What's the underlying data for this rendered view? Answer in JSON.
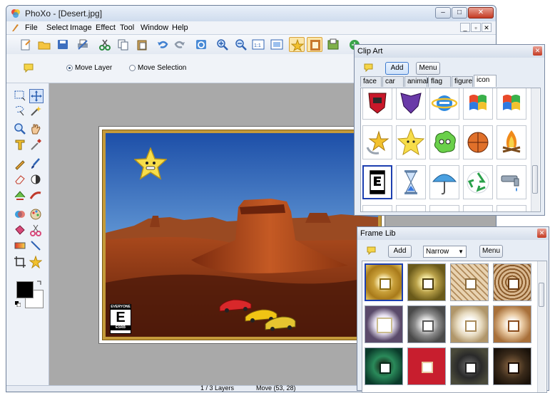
{
  "app": {
    "title": "PhoXo - [Desert.jpg]",
    "menus": [
      "File",
      "Select",
      "Image",
      "Effect",
      "Tool",
      "Window",
      "Help"
    ]
  },
  "toolbar_icons": [
    "new-file",
    "open-folder",
    "save",
    "print",
    "cut",
    "copy",
    "paste",
    "undo",
    "redo",
    "refresh",
    "zoom-in",
    "zoom-out",
    "actual-size",
    "fit-window",
    "star-tool",
    "frame-tool",
    "export",
    "globe"
  ],
  "options": {
    "move_layer": "Move Layer",
    "move_selection": "Move Selection",
    "selected": "move_layer"
  },
  "status": {
    "layers": "1 / 3 Layers",
    "position": "Move (53, 28)"
  },
  "clipart": {
    "title": "Clip Art",
    "add_label": "Add",
    "menu_label": "Menu",
    "tabs": [
      "face",
      "car",
      "animal",
      "flag",
      "figure",
      "icon"
    ],
    "active_tab": "icon",
    "items": [
      "autobots-icon",
      "decepticons-icon",
      "internet-explorer-icon",
      "windows-flag-blue-icon",
      "windows-flag-icon",
      "star-swoosh-icon",
      "smiling-star-icon",
      "green-blob-face-icon",
      "basketball-icon",
      "campfire-icon",
      "esrb-everyone-icon",
      "hourglass-icon",
      "umbrella-icon",
      "recycle-icon",
      "faucet-icon"
    ]
  },
  "framelib": {
    "title": "Frame Lib",
    "add_label": "Add",
    "style_value": "Narrow",
    "menu_label": "Menu",
    "frames": [
      "gold-frame",
      "olive-frame",
      "beige-pattern-frame",
      "brown-wave-frame",
      "purple-frame",
      "grey-frame",
      "cream-frame",
      "tan-frame",
      "green-frame",
      "red-frame",
      "dark-grey-frame",
      "dark-brown-frame"
    ]
  },
  "canvas": {
    "esrb_rating": "E",
    "esrb_top": "EVERYONE",
    "esrb_bottom": "ESRB"
  },
  "colors": {
    "foreground": "#000000",
    "background": "#ffffff",
    "frame_border": "#c49a3a",
    "selection": "#1d3fb0"
  }
}
